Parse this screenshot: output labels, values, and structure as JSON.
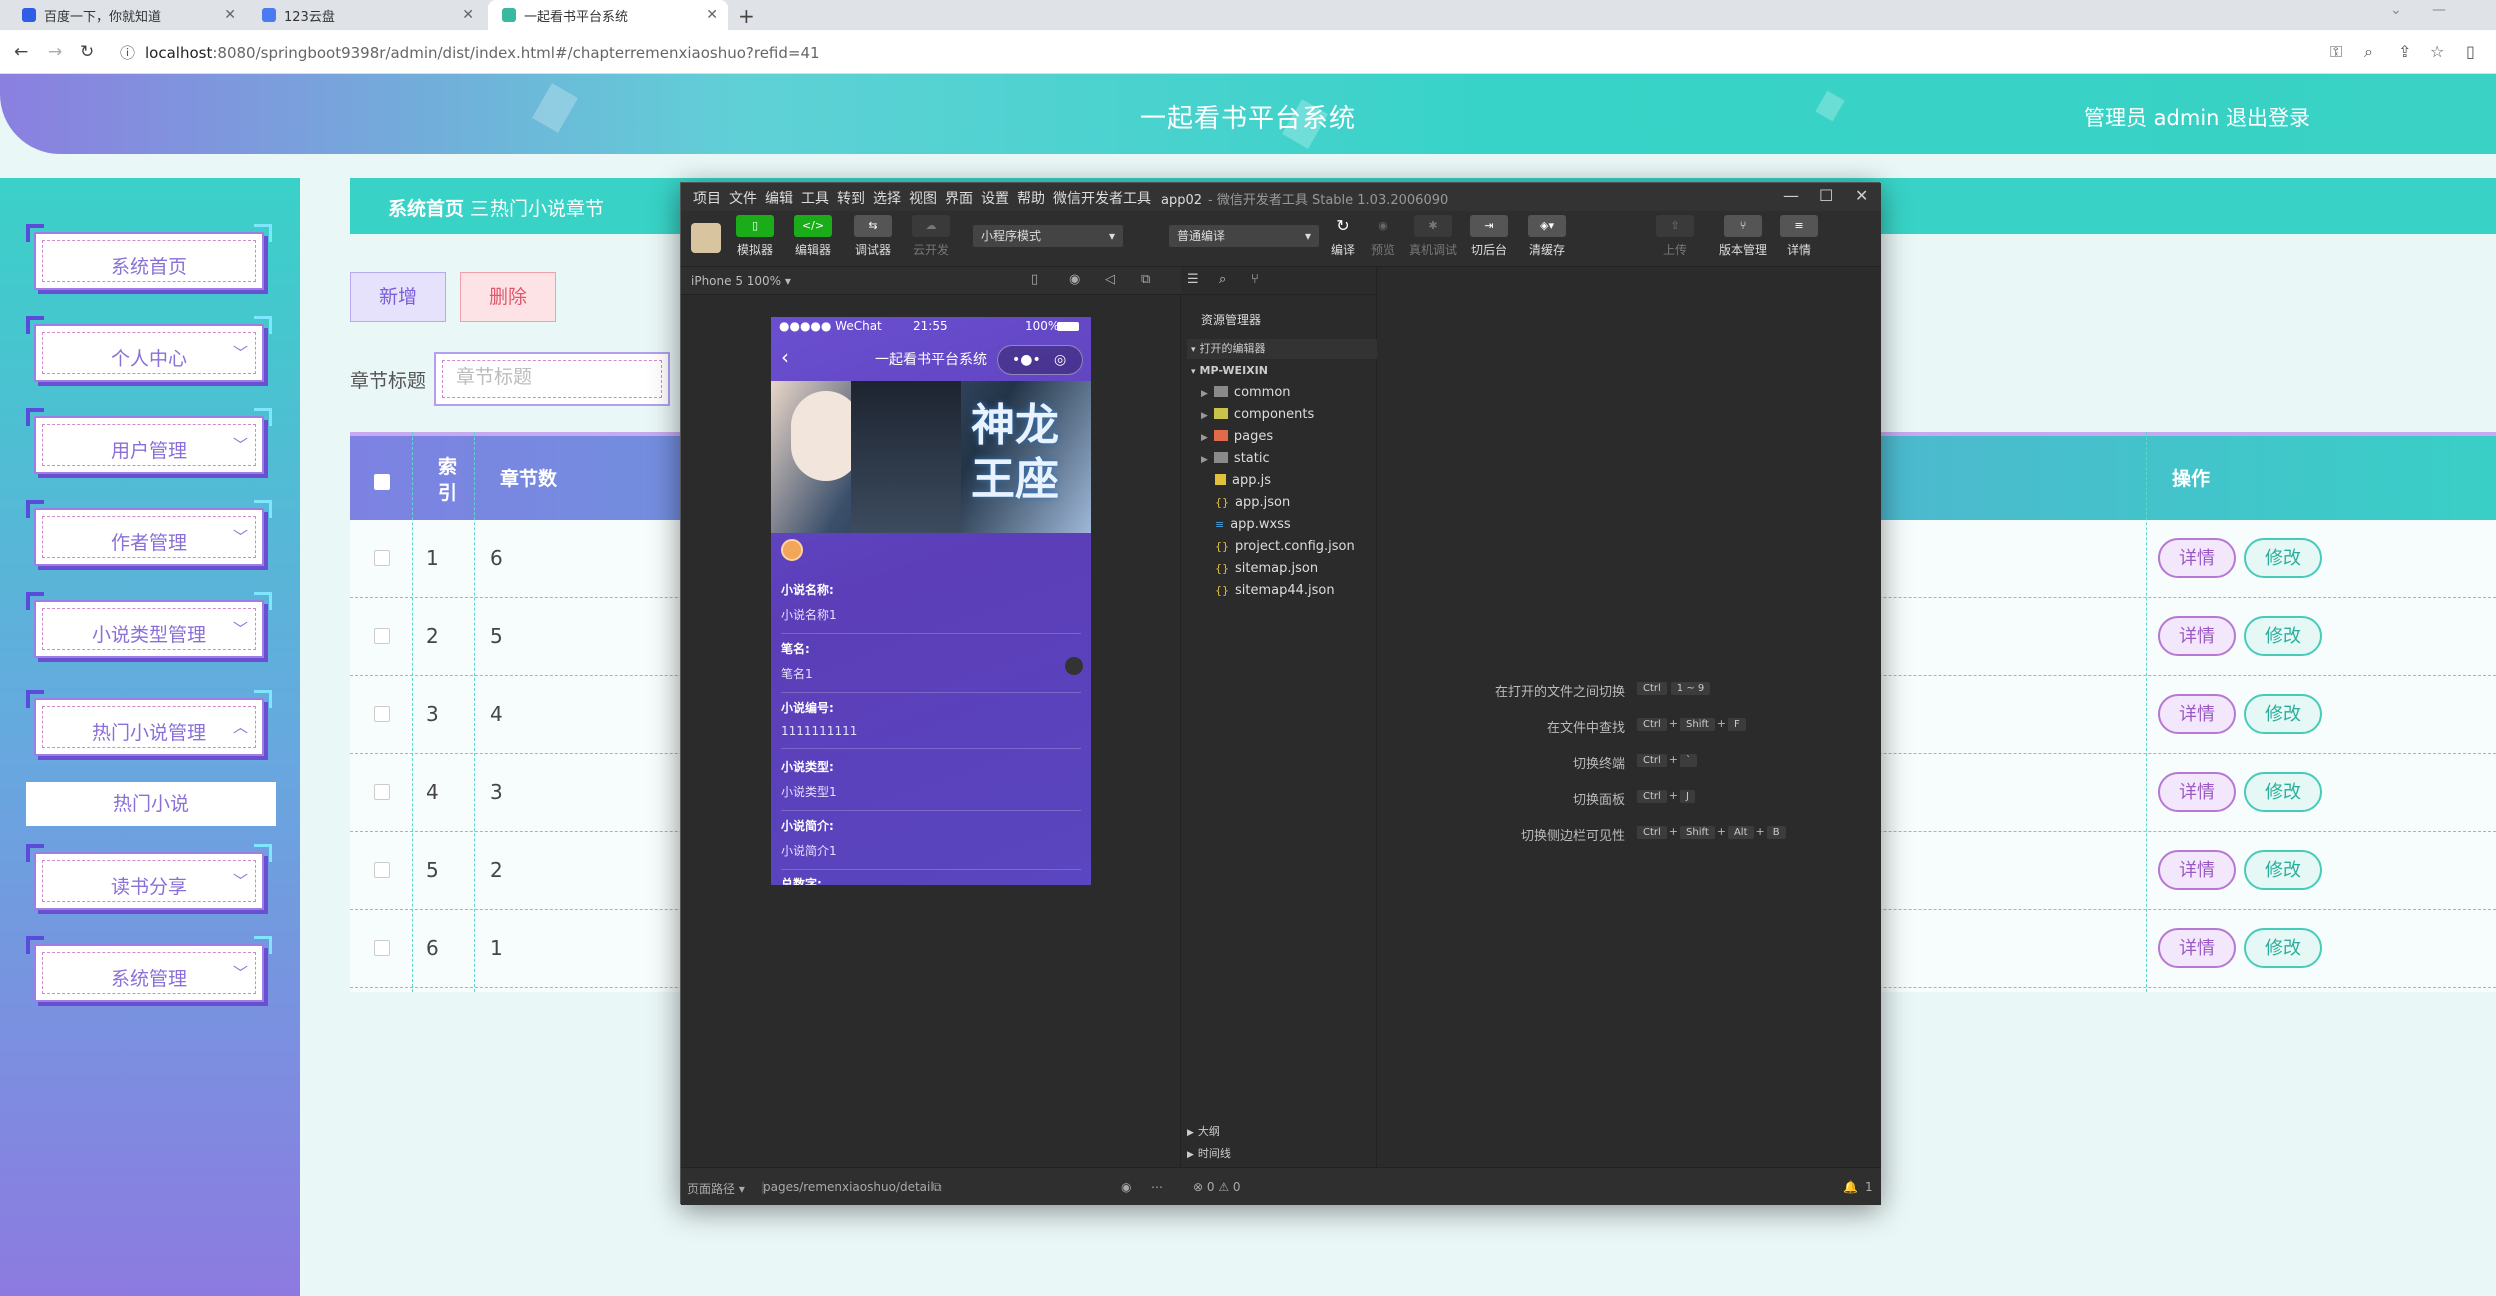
{
  "browser": {
    "tabs": [
      {
        "title": "百度一下，你就知道"
      },
      {
        "title": "123云盘"
      },
      {
        "title": "一起看书平台系统"
      }
    ],
    "url_host": "localhost",
    "url_rest": ":8080/springboot9398r/admin/dist/index.html#/chapterremenxiaoshuo?refid=41"
  },
  "app": {
    "title": "一起看书平台系统",
    "user": "管理员 admin",
    "logout": "退出登录"
  },
  "sidebar": {
    "items": [
      {
        "label": "系统首页"
      },
      {
        "label": "个人中心"
      },
      {
        "label": "用户管理"
      },
      {
        "label": "作者管理"
      },
      {
        "label": "小说类型管理"
      },
      {
        "label": "热门小说管理"
      },
      {
        "label": "读书分享"
      },
      {
        "label": "系统管理"
      }
    ],
    "submenu": "热门小说"
  },
  "breadcrumb": {
    "home": "系统首页",
    "sep": "三",
    "current": "热门小说章节"
  },
  "toolbar": {
    "add": "新增",
    "delete": "删除"
  },
  "search": {
    "label": "章节标题",
    "placeholder": "章节标题"
  },
  "table": {
    "headers": {
      "index": "索引",
      "chapter": "章节数",
      "ops": "操作"
    },
    "rows": [
      {
        "index": "1",
        "chapter": "6"
      },
      {
        "index": "2",
        "chapter": "5"
      },
      {
        "index": "3",
        "chapter": "4"
      },
      {
        "index": "4",
        "chapter": "3"
      },
      {
        "index": "5",
        "chapter": "2"
      },
      {
        "index": "6",
        "chapter": "1"
      }
    ],
    "detail_label": "详情",
    "edit_label": "修改"
  },
  "devtools": {
    "menu": [
      "项目",
      "文件",
      "编辑",
      "工具",
      "转到",
      "选择",
      "视图",
      "界面",
      "设置",
      "帮助",
      "微信开发者工具"
    ],
    "title_app": "app02",
    "title_rest": "- 微信开发者工具 Stable 1.03.2006090",
    "tools_left": [
      "模拟器",
      "编辑器",
      "调试器",
      "云开发"
    ],
    "mode_select": "小程序模式",
    "compile_select": "普通编译",
    "tools_mid": [
      "编译",
      "预览",
      "真机调试",
      "切后台",
      "清缓存"
    ],
    "tools_right": [
      "上传",
      "版本管理",
      "详情"
    ],
    "device": "iPhone 5 100% ▾",
    "phone": {
      "carrier": "●●●●● WeChat",
      "time": "21:55",
      "battery": "100%",
      "nav_title": "一起看书平台系统",
      "banner_text": "神龙王座",
      "fields": [
        {
          "k": "小说名称:",
          "v": "小说名称1"
        },
        {
          "k": "笔名:",
          "v": "笔名1"
        },
        {
          "k": "小说编号:",
          "v": "1111111111"
        },
        {
          "k": "小说类型:",
          "v": "小说类型1"
        },
        {
          "k": "小说简介:",
          "v": "小说简介1"
        },
        {
          "k": "总数字:",
          "v": ""
        }
      ]
    },
    "explorer": {
      "header": "资源管理器",
      "open_editors": "打开的编辑器",
      "project": "MP-WEIXIN",
      "folders": [
        "common",
        "components",
        "pages",
        "static"
      ],
      "files": [
        "app.js",
        "app.json",
        "app.wxss",
        "project.config.json",
        "sitemap.json",
        "sitemap44.json"
      ],
      "outline": "大纲",
      "timeline": "时间线"
    },
    "shortcuts": [
      {
        "desc": "在打开的文件之间切换",
        "keys": [
          "Ctrl",
          "1 ~ 9"
        ]
      },
      {
        "desc": "在文件中查找",
        "keys": [
          "Ctrl",
          "+",
          "Shift",
          "+",
          "F"
        ]
      },
      {
        "desc": "切换终端",
        "keys": [
          "Ctrl",
          "+",
          "`"
        ]
      },
      {
        "desc": "切换面板",
        "keys": [
          "Ctrl",
          "+",
          "J"
        ]
      },
      {
        "desc": "切换侧边栏可见性",
        "keys": [
          "Ctrl",
          "+",
          "Shift",
          "+",
          "Alt",
          "+",
          "B"
        ]
      }
    ],
    "footer": {
      "path_label": "页面路径 ▾",
      "path": "pages/remenxiaoshuo/detail",
      "status": "⊗ 0 ⚠ 0",
      "bell": "1"
    }
  }
}
